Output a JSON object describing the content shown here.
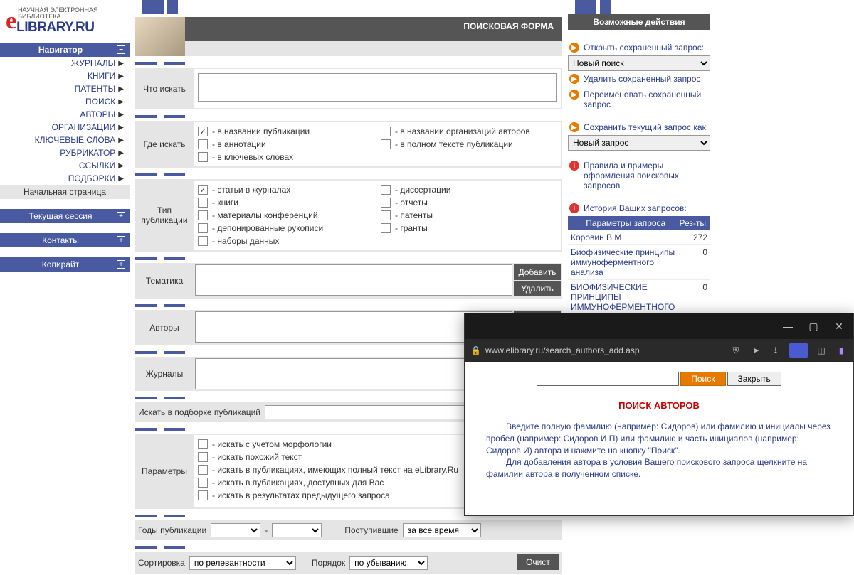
{
  "logo": {
    "sub1": "НАУЧНАЯ ЭЛЕКТРОННАЯ",
    "sub2": "БИБЛИОТЕКА",
    "lib": "LIBRARY.RU"
  },
  "nav": {
    "header": "Навигатор",
    "items": [
      "ЖУРНАЛЫ",
      "КНИГИ",
      "ПАТЕНТЫ",
      "ПОИСК",
      "АВТОРЫ",
      "ОРГАНИЗАЦИИ",
      "КЛЮЧЕВЫЕ СЛОВА",
      "РУБРИКАТОР",
      "ССЫЛКИ",
      "ПОДБОРКИ"
    ],
    "home": "Начальная страница",
    "side": [
      "Текущая сессия",
      "Контакты",
      "Копирайт"
    ]
  },
  "form": {
    "title": "ПОИСКОВАЯ ФОРМА",
    "what": "Что искать",
    "where": "Где искать",
    "where_opts": [
      {
        "label": "- в названии публикации",
        "checked": true
      },
      {
        "label": "- в названии организаций авторов",
        "checked": false
      },
      {
        "label": "- в аннотации",
        "checked": false
      },
      {
        "label": "- в полном тексте публикации",
        "checked": false
      },
      {
        "label": "- в ключевых словах",
        "checked": false
      }
    ],
    "type": "Тип публикации",
    "type_opts": [
      {
        "label": "- статьи в журналах",
        "checked": true
      },
      {
        "label": "- диссертации",
        "checked": false
      },
      {
        "label": "- книги",
        "checked": false
      },
      {
        "label": "- отчеты",
        "checked": false
      },
      {
        "label": "- материалы конференций",
        "checked": false
      },
      {
        "label": "- патенты",
        "checked": false
      },
      {
        "label": "- депонированные рукописи",
        "checked": false
      },
      {
        "label": "- гранты",
        "checked": false
      },
      {
        "label": "- наборы данных",
        "checked": false
      }
    ],
    "tema": "Тематика",
    "authors": "Авторы",
    "journals": "Журналы",
    "add": "Добавить",
    "del": "Удалить",
    "subset": "Искать в подборке публикаций",
    "params": "Параметры",
    "param_opts": [
      "- искать с учетом морфологии",
      "- искать похожий текст",
      "- искать в публикациях, имеющих полный текст на eLibrary.Ru",
      "- искать в публикациях, доступных для Вас",
      "- искать в результатах предыдущего запроса"
    ],
    "years": "Годы публикации",
    "dash": "-",
    "received": "Поступившие",
    "received_val": "за все время",
    "sort": "Сортировка",
    "sort_val": "по релевантности",
    "order": "Порядок",
    "order_val": "по убыванию",
    "clear": "Очист"
  },
  "right": {
    "header": "Возможные действия",
    "open": "Открыть сохраненный запрос:",
    "open_val": "Новый поиск",
    "del": "Удалить сохраненный запрос",
    "rename": "Переименовать сохраненный запрос",
    "save": "Сохранить текущий запрос как:",
    "save_val": "Новый запрос",
    "rules": "Правила и примеры оформления поисковых запросов",
    "history": "История Ваших запросов:",
    "hist_h1": "Параметры запроса",
    "hist_h2": "Рез-ты",
    "rows": [
      {
        "q": "Коровин В М",
        "n": "272"
      },
      {
        "q": "Биофизические принципы иммуноферментного анализа",
        "n": "0"
      },
      {
        "q": "БИОФИЗИЧЕСКИЕ ПРИНЦИПЫ ИММУНОФЕРМЕНТНОГО АНАЛИЗА",
        "n": "0"
      }
    ]
  },
  "popup": {
    "url": "www.elibrary.ru/search_authors_add.asp",
    "search": "Поиск",
    "close": "Закрыть",
    "title": "ПОИСК АВТОРОВ",
    "p1": "Введите полную фамилию (например: Сидоров) или фамилию и инициалы через пробел (например: Сидоров И П) или фамилию и часть инициалов (например: Сидоров И) автора и нажмите на кнопку \"Поиск\".",
    "p2": "Для добавления автора в условия Вашего поискового запроса щелкните на фамилии автора в полученном списке."
  }
}
